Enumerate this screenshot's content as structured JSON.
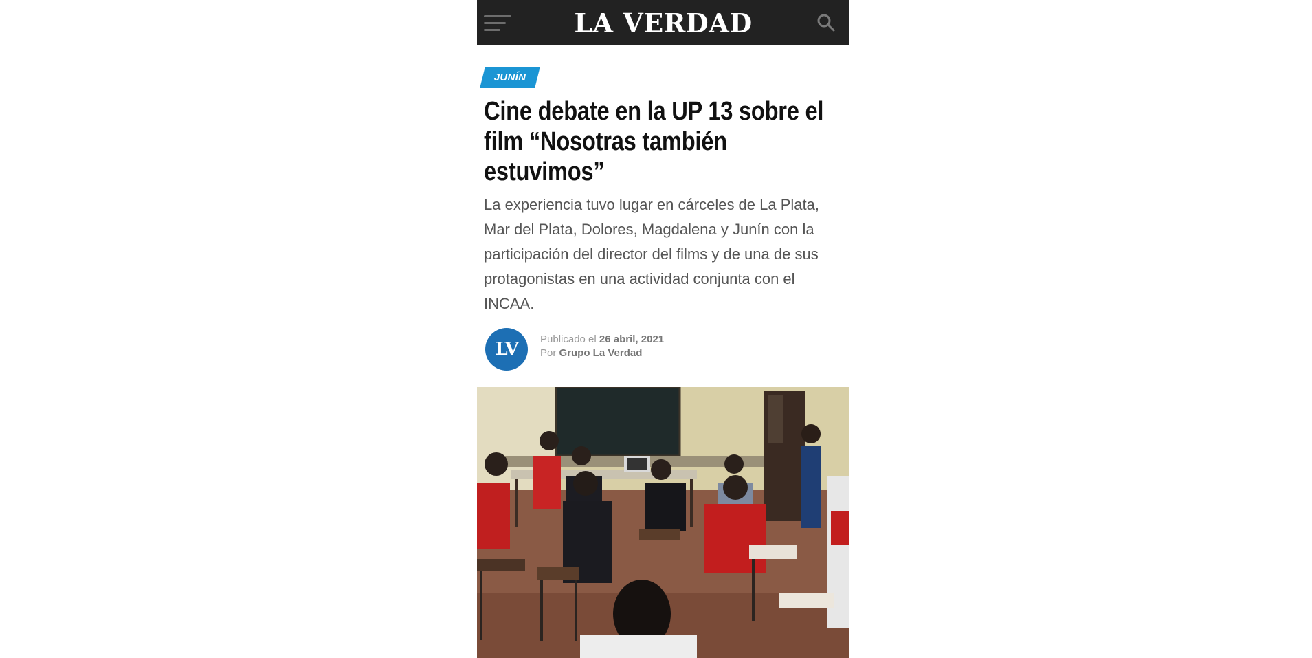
{
  "header": {
    "logo_text": "LA VERDAD",
    "menu_icon": "hamburger-menu-icon",
    "search_icon": "search-icon"
  },
  "article": {
    "category": "JUNÍN",
    "headline": "Cine debate en la UP 13 sobre el film “Nosotras también estuvimos”",
    "summary": "La experiencia tuvo lugar en cárceles de La Plata, Mar del Plata, Dolores, Magdalena y Junín con la participación del director del films y de una de sus protagonistas en una actividad conjunta con el INCAA.",
    "author_avatar_text": "LV",
    "published_prefix": "Publicado el",
    "published_date": "26 abril, 2021",
    "author_prefix": "Por",
    "author_name": "Grupo La Verdad"
  },
  "colors": {
    "topbar": "#222222",
    "category_bg": "#1b95d4",
    "avatar_bg": "#1d6fb4"
  }
}
